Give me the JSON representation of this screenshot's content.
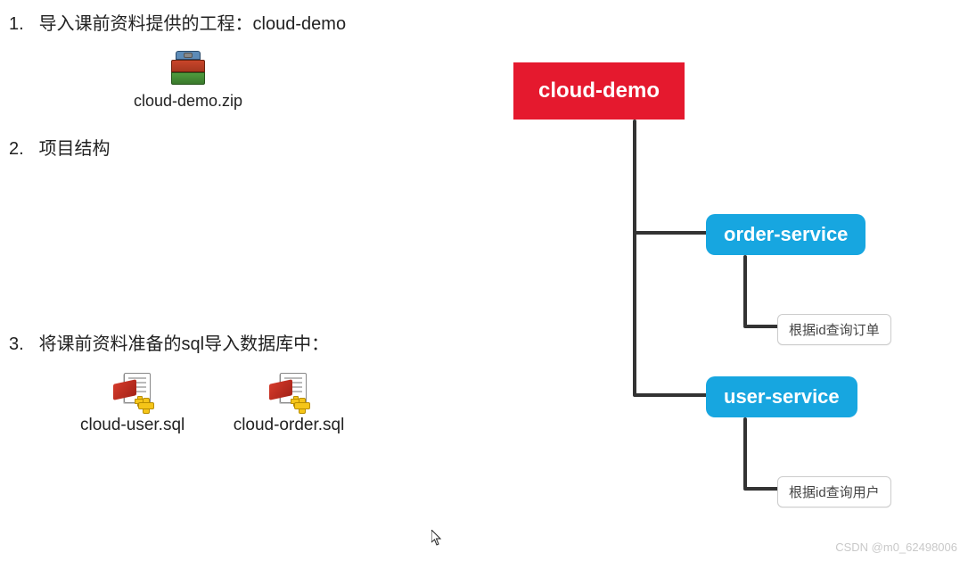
{
  "steps": {
    "s1": {
      "num": "1.",
      "text": "导入课前资料提供的工程：cloud-demo"
    },
    "s2": {
      "num": "2.",
      "text": "项目结构"
    },
    "s3": {
      "num": "3.",
      "text": "将课前资料准备的sql导入数据库中："
    }
  },
  "files": {
    "zip_name": "cloud-demo.zip",
    "sql_user": "cloud-user.sql",
    "sql_order": "cloud-order.sql"
  },
  "tree": {
    "root": "cloud-demo",
    "order_service": "order-service",
    "order_leaf": "根据id查询订单",
    "user_service": "user-service",
    "user_leaf": "根据id查询用户"
  },
  "colors": {
    "root_bg": "#e5192e",
    "service_bg": "#17a6e0",
    "leaf_border": "#cccccc",
    "connector": "#333333"
  },
  "watermark": "CSDN @m0_62498006"
}
